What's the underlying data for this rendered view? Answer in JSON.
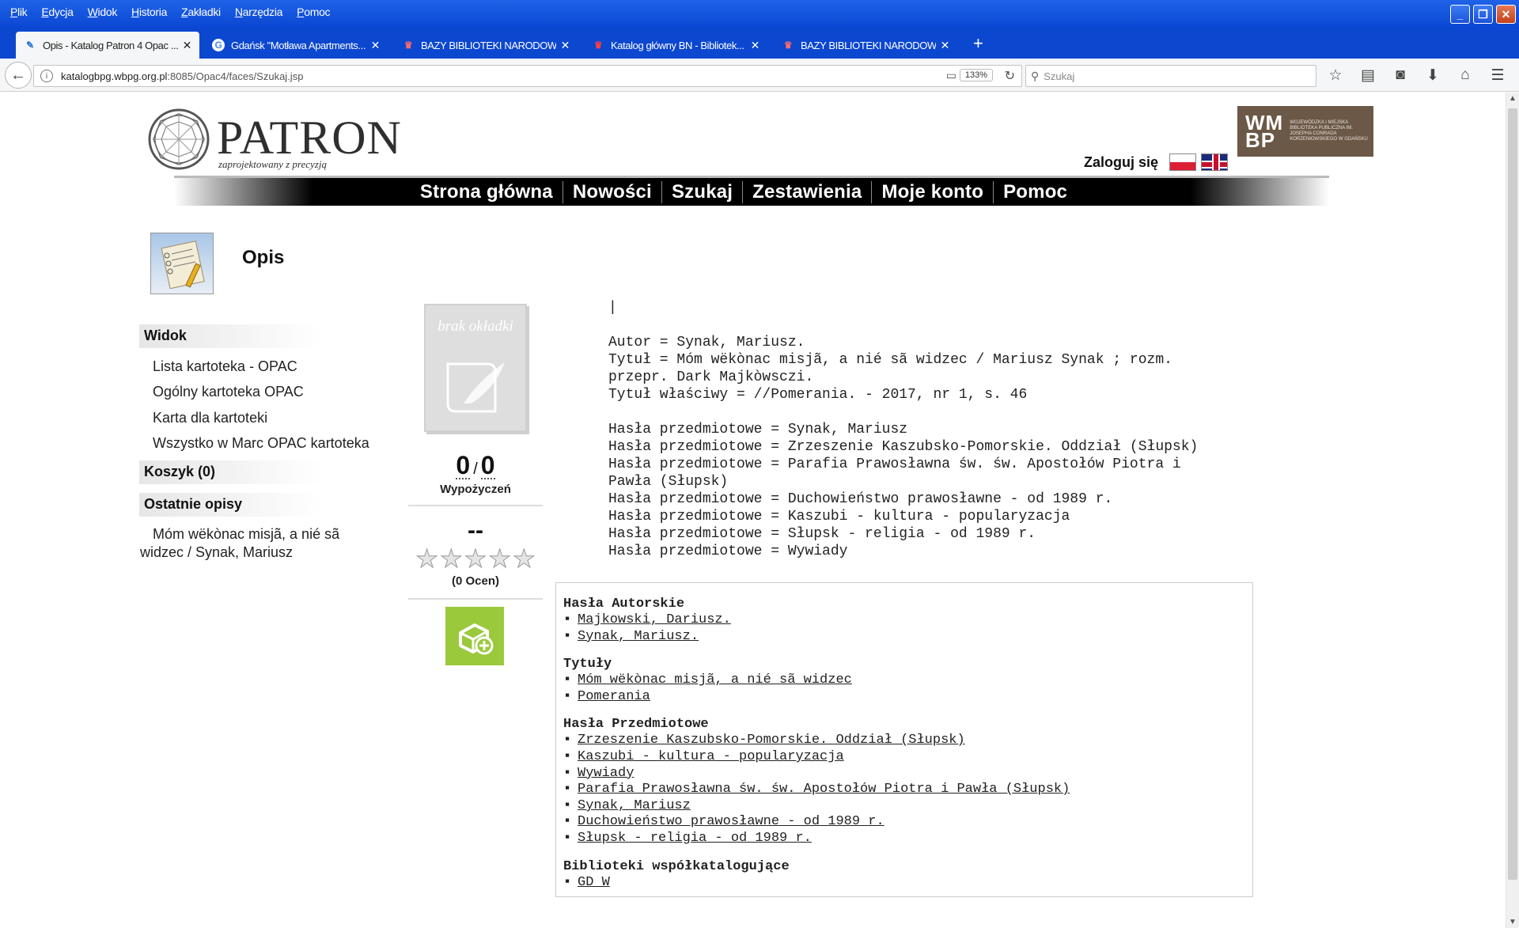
{
  "browser": {
    "menu": [
      "Plik",
      "Edycja",
      "Widok",
      "Historia",
      "Zakładki",
      "Narzędzia",
      "Pomoc"
    ],
    "tabs": [
      {
        "label": "Opis - Katalog Patron 4 Opac ...",
        "active": true
      },
      {
        "label": "Gdańsk \"Motława Apartments...",
        "active": false
      },
      {
        "label": "BAZY BIBLIOTEKI NARODOWEJ",
        "active": false
      },
      {
        "label": "Katalog główny BN - Bibliotek...",
        "active": false
      },
      {
        "label": "BAZY BIBLIOTEKI NARODOWEJ",
        "active": false
      }
    ],
    "url_host": "katalogbpg.wbpg.org.pl",
    "url_rest": ":8085/Opac4/faces/Szukaj.jsp",
    "zoom": "133%",
    "search_placeholder": "Szukaj"
  },
  "header": {
    "logo_word": "PATRON",
    "logo_tagline": "zaprojektowany z precyzją",
    "library_mark": "WM BP",
    "library_text": "WOJEWÓDZKA I MIEJSKA BIBLIOTEKA PUBLICZNA IM. JOSEPHA CONRADA KORZENIOWSKIEGO W GDAŃSKU",
    "login": "Zaloguj się"
  },
  "nav": [
    "Strona główna",
    "Nowości",
    "Szukaj",
    "Zestawienia",
    "Moje konto",
    "Pomoc"
  ],
  "page": {
    "title": "Opis"
  },
  "sidebar": {
    "widok_head": "Widok",
    "widok_links": [
      "Lista kartoteka - OPAC",
      "Ogólny kartoteka OPAC",
      "Karta dla kartoteki",
      "Wszystko w Marc OPAC kartoteka"
    ],
    "koszyk": "Koszyk (0)",
    "recent_head": "Ostatnie opisy",
    "recent_item": "Móm wëkònac misjã, a nié sã widzec / Synak, Mariusz"
  },
  "item": {
    "cover_text": "brak okładki",
    "loans_a": "0",
    "loans_b": "0",
    "loans_label": "Wypożyczeń",
    "rating_value": "--",
    "rating_count": "(0 Ocen)"
  },
  "description": [
    "",
    "Autor = Synak, Mariusz.",
    "Tytuł = Móm wëkònac misjã, a nié sã widzec / Mariusz Synak ; rozm.",
    "przepr. Dark Majkòwsczi.",
    "Tytuł właściwy = //Pomerania. - 2017, nr 1, s. 46",
    "",
    "Hasła przedmiotowe = Synak, Mariusz",
    "Hasła przedmiotowe = Zrzeszenie Kaszubsko-Pomorskie. Oddział (Słupsk)",
    "Hasła przedmiotowe = Parafia Prawosławna św. św. Apostołów Piotra i",
    "Pawła (Słupsk)",
    "Hasła przedmiotowe = Duchowieństwo prawosławne - od 1989 r.",
    "Hasła przedmiotowe = Kaszubi - kultura - popularyzacja",
    "Hasła przedmiotowe = Słupsk - religia - od 1989 r.",
    "Hasła przedmiotowe = Wywiady"
  ],
  "hasla": {
    "authors_head": "Hasła Autorskie",
    "authors": [
      "Majkowski, Dariusz.",
      "Synak, Mariusz."
    ],
    "titles_head": "Tytuły",
    "titles": [
      "Móm wëkònac misjã, a nié sã widzec",
      "Pomerania"
    ],
    "subjects_head": "Hasła Przedmiotowe",
    "subjects": [
      "Zrzeszenie Kaszubsko-Pomorskie. Oddział (Słupsk)",
      "Kaszubi - kultura - popularyzacja",
      "Wywiady",
      "Parafia Prawosławna św. św. Apostołów Piotra i Pawła (Słupsk)",
      "Synak, Mariusz",
      "Duchowieństwo prawosławne - od 1989 r.",
      "Słupsk - religia - od 1989 r."
    ],
    "libraries_head": "Biblioteki współkatalogujące",
    "libraries": [
      "GD W"
    ]
  }
}
